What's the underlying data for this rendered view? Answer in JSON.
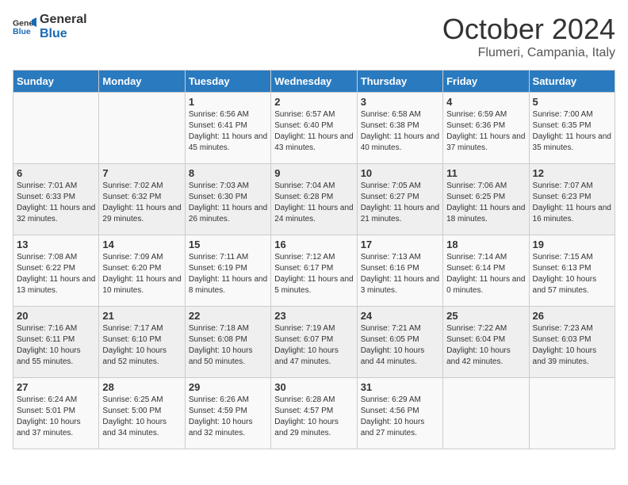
{
  "logo": {
    "line1": "General",
    "line2": "Blue"
  },
  "title": "October 2024",
  "location": "Flumeri, Campania, Italy",
  "days_of_week": [
    "Sunday",
    "Monday",
    "Tuesday",
    "Wednesday",
    "Thursday",
    "Friday",
    "Saturday"
  ],
  "weeks": [
    [
      {
        "day": "",
        "sunrise": "",
        "sunset": "",
        "daylight": ""
      },
      {
        "day": "",
        "sunrise": "",
        "sunset": "",
        "daylight": ""
      },
      {
        "day": "1",
        "sunrise": "Sunrise: 6:56 AM",
        "sunset": "Sunset: 6:41 PM",
        "daylight": "Daylight: 11 hours and 45 minutes."
      },
      {
        "day": "2",
        "sunrise": "Sunrise: 6:57 AM",
        "sunset": "Sunset: 6:40 PM",
        "daylight": "Daylight: 11 hours and 43 minutes."
      },
      {
        "day": "3",
        "sunrise": "Sunrise: 6:58 AM",
        "sunset": "Sunset: 6:38 PM",
        "daylight": "Daylight: 11 hours and 40 minutes."
      },
      {
        "day": "4",
        "sunrise": "Sunrise: 6:59 AM",
        "sunset": "Sunset: 6:36 PM",
        "daylight": "Daylight: 11 hours and 37 minutes."
      },
      {
        "day": "5",
        "sunrise": "Sunrise: 7:00 AM",
        "sunset": "Sunset: 6:35 PM",
        "daylight": "Daylight: 11 hours and 35 minutes."
      }
    ],
    [
      {
        "day": "6",
        "sunrise": "Sunrise: 7:01 AM",
        "sunset": "Sunset: 6:33 PM",
        "daylight": "Daylight: 11 hours and 32 minutes."
      },
      {
        "day": "7",
        "sunrise": "Sunrise: 7:02 AM",
        "sunset": "Sunset: 6:32 PM",
        "daylight": "Daylight: 11 hours and 29 minutes."
      },
      {
        "day": "8",
        "sunrise": "Sunrise: 7:03 AM",
        "sunset": "Sunset: 6:30 PM",
        "daylight": "Daylight: 11 hours and 26 minutes."
      },
      {
        "day": "9",
        "sunrise": "Sunrise: 7:04 AM",
        "sunset": "Sunset: 6:28 PM",
        "daylight": "Daylight: 11 hours and 24 minutes."
      },
      {
        "day": "10",
        "sunrise": "Sunrise: 7:05 AM",
        "sunset": "Sunset: 6:27 PM",
        "daylight": "Daylight: 11 hours and 21 minutes."
      },
      {
        "day": "11",
        "sunrise": "Sunrise: 7:06 AM",
        "sunset": "Sunset: 6:25 PM",
        "daylight": "Daylight: 11 hours and 18 minutes."
      },
      {
        "day": "12",
        "sunrise": "Sunrise: 7:07 AM",
        "sunset": "Sunset: 6:23 PM",
        "daylight": "Daylight: 11 hours and 16 minutes."
      }
    ],
    [
      {
        "day": "13",
        "sunrise": "Sunrise: 7:08 AM",
        "sunset": "Sunset: 6:22 PM",
        "daylight": "Daylight: 11 hours and 13 minutes."
      },
      {
        "day": "14",
        "sunrise": "Sunrise: 7:09 AM",
        "sunset": "Sunset: 6:20 PM",
        "daylight": "Daylight: 11 hours and 10 minutes."
      },
      {
        "day": "15",
        "sunrise": "Sunrise: 7:11 AM",
        "sunset": "Sunset: 6:19 PM",
        "daylight": "Daylight: 11 hours and 8 minutes."
      },
      {
        "day": "16",
        "sunrise": "Sunrise: 7:12 AM",
        "sunset": "Sunset: 6:17 PM",
        "daylight": "Daylight: 11 hours and 5 minutes."
      },
      {
        "day": "17",
        "sunrise": "Sunrise: 7:13 AM",
        "sunset": "Sunset: 6:16 PM",
        "daylight": "Daylight: 11 hours and 3 minutes."
      },
      {
        "day": "18",
        "sunrise": "Sunrise: 7:14 AM",
        "sunset": "Sunset: 6:14 PM",
        "daylight": "Daylight: 11 hours and 0 minutes."
      },
      {
        "day": "19",
        "sunrise": "Sunrise: 7:15 AM",
        "sunset": "Sunset: 6:13 PM",
        "daylight": "Daylight: 10 hours and 57 minutes."
      }
    ],
    [
      {
        "day": "20",
        "sunrise": "Sunrise: 7:16 AM",
        "sunset": "Sunset: 6:11 PM",
        "daylight": "Daylight: 10 hours and 55 minutes."
      },
      {
        "day": "21",
        "sunrise": "Sunrise: 7:17 AM",
        "sunset": "Sunset: 6:10 PM",
        "daylight": "Daylight: 10 hours and 52 minutes."
      },
      {
        "day": "22",
        "sunrise": "Sunrise: 7:18 AM",
        "sunset": "Sunset: 6:08 PM",
        "daylight": "Daylight: 10 hours and 50 minutes."
      },
      {
        "day": "23",
        "sunrise": "Sunrise: 7:19 AM",
        "sunset": "Sunset: 6:07 PM",
        "daylight": "Daylight: 10 hours and 47 minutes."
      },
      {
        "day": "24",
        "sunrise": "Sunrise: 7:21 AM",
        "sunset": "Sunset: 6:05 PM",
        "daylight": "Daylight: 10 hours and 44 minutes."
      },
      {
        "day": "25",
        "sunrise": "Sunrise: 7:22 AM",
        "sunset": "Sunset: 6:04 PM",
        "daylight": "Daylight: 10 hours and 42 minutes."
      },
      {
        "day": "26",
        "sunrise": "Sunrise: 7:23 AM",
        "sunset": "Sunset: 6:03 PM",
        "daylight": "Daylight: 10 hours and 39 minutes."
      }
    ],
    [
      {
        "day": "27",
        "sunrise": "Sunrise: 6:24 AM",
        "sunset": "Sunset: 5:01 PM",
        "daylight": "Daylight: 10 hours and 37 minutes."
      },
      {
        "day": "28",
        "sunrise": "Sunrise: 6:25 AM",
        "sunset": "Sunset: 5:00 PM",
        "daylight": "Daylight: 10 hours and 34 minutes."
      },
      {
        "day": "29",
        "sunrise": "Sunrise: 6:26 AM",
        "sunset": "Sunset: 4:59 PM",
        "daylight": "Daylight: 10 hours and 32 minutes."
      },
      {
        "day": "30",
        "sunrise": "Sunrise: 6:28 AM",
        "sunset": "Sunset: 4:57 PM",
        "daylight": "Daylight: 10 hours and 29 minutes."
      },
      {
        "day": "31",
        "sunrise": "Sunrise: 6:29 AM",
        "sunset": "Sunset: 4:56 PM",
        "daylight": "Daylight: 10 hours and 27 minutes."
      },
      {
        "day": "",
        "sunrise": "",
        "sunset": "",
        "daylight": ""
      },
      {
        "day": "",
        "sunrise": "",
        "sunset": "",
        "daylight": ""
      }
    ]
  ]
}
